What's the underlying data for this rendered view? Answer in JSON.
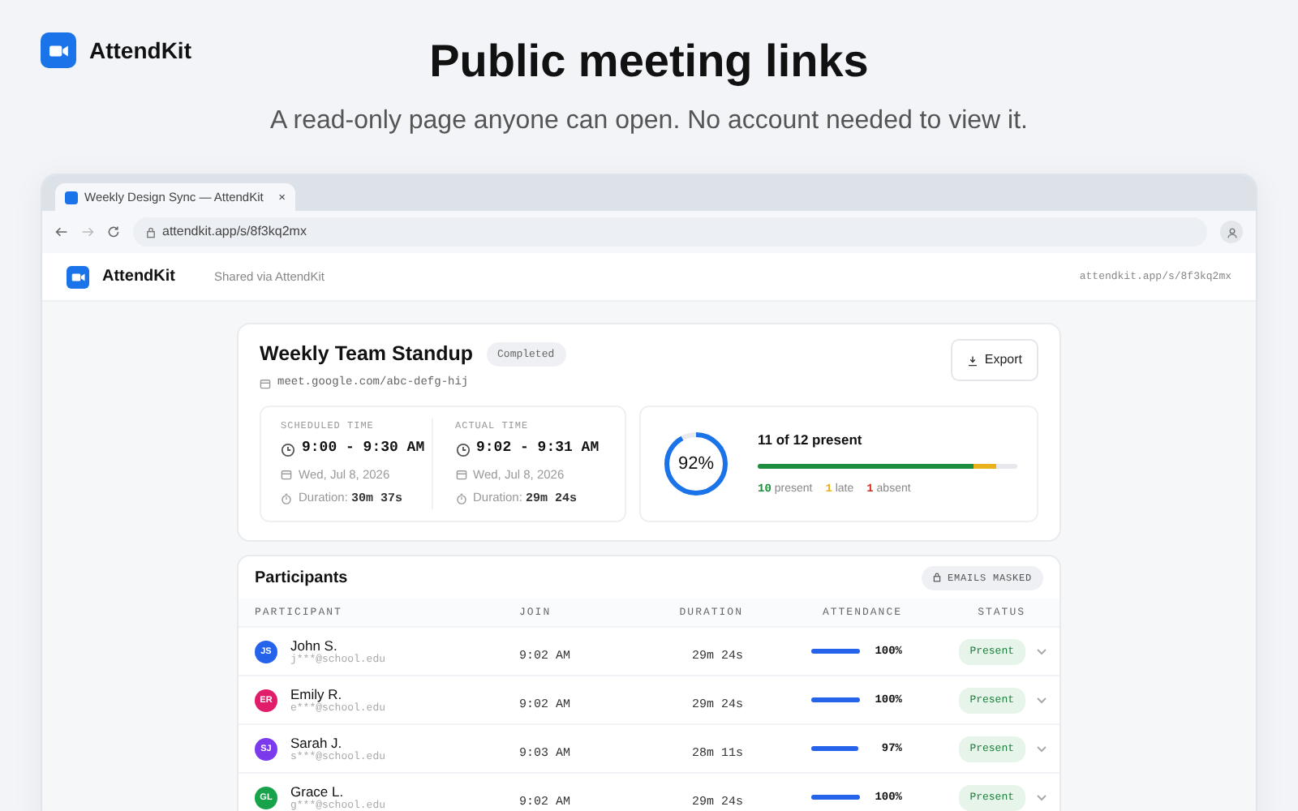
{
  "brand": {
    "name": "AttendKit"
  },
  "hero": {
    "title": "Public meeting links",
    "subtitle": "A read-only page anyone can open. No account needed to view it."
  },
  "browser": {
    "tab_title": "Weekly Design Sync — AttendKit",
    "tab_close": "×",
    "url": "attendkit.app/s/8f3kq2mx"
  },
  "app_header": {
    "name": "AttendKit",
    "shared_via": "Shared via AttendKit",
    "link": "attendkit.app/s/8f3kq2mx"
  },
  "meeting": {
    "title": "Weekly Team Standup",
    "status": "Completed",
    "link": "meet.google.com/abc-defg-hij",
    "export_label": "Export",
    "times": [
      {
        "label": "SCHEDULED TIME",
        "range": "9:00 - 9:30 AM",
        "date": "Wed, Jul 8, 2026",
        "duration_label": "Duration:",
        "duration": "30m 37s"
      },
      {
        "label": "ACTUAL TIME",
        "range": "9:02 - 9:31 AM",
        "date": "Wed, Jul 8, 2026",
        "duration_label": "Duration:",
        "duration": "29m 24s"
      }
    ],
    "rate": {
      "percent": "92%",
      "level": 0.92,
      "summary": "11 of 12 present"
    },
    "breakdown": [
      {
        "kind": "present",
        "count": "10",
        "label": "present",
        "color": "#1e8e3e"
      },
      {
        "kind": "late",
        "count": "1",
        "label": "late",
        "color": "#e9b21a"
      },
      {
        "kind": "absent",
        "count": "1",
        "label": "absent",
        "color": "#d93025"
      }
    ]
  },
  "participants": {
    "title": "Participants",
    "masked_badge": "EMAILS MASKED",
    "columns": [
      "PARTICIPANT",
      "JOIN",
      "DURATION",
      "ATTENDANCE",
      "STATUS"
    ],
    "rows": [
      {
        "initials": "JS",
        "color": "#2563eb",
        "name": "John S.",
        "email": "j***@school.edu",
        "join": "9:02 AM",
        "duration": "29m 24s",
        "level": 1.0,
        "attendance": "100%",
        "status": "Present"
      },
      {
        "initials": "ER",
        "color": "#e11d6a",
        "name": "Emily R.",
        "email": "e***@school.edu",
        "join": "9:02 AM",
        "duration": "29m 24s",
        "level": 1.0,
        "attendance": "100%",
        "status": "Present"
      },
      {
        "initials": "SJ",
        "color": "#7c3aed",
        "name": "Sarah J.",
        "email": "s***@school.edu",
        "join": "9:03 AM",
        "duration": "28m 11s",
        "level": 0.97,
        "attendance": "97%",
        "status": "Present"
      },
      {
        "initials": "GL",
        "color": "#16a34a",
        "name": "Grace L.",
        "email": "g***@school.edu",
        "join": "9:02 AM",
        "duration": "29m 24s",
        "level": 1.0,
        "attendance": "100%",
        "status": "Present"
      }
    ]
  }
}
